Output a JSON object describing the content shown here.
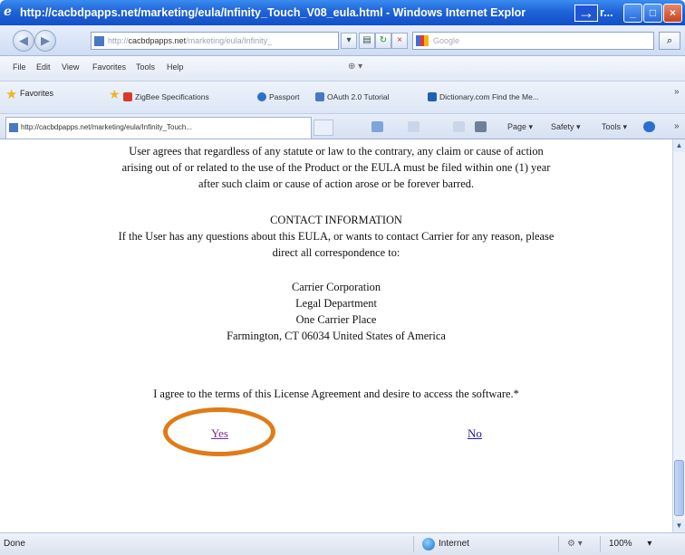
{
  "window": {
    "title": "http://cacbdpapps.net/marketing/eula/Infinity_Touch_V08_eula.html - Windows Internet Explor",
    "title_tail": "r...",
    "min_glyph": "_",
    "max_glyph": "□",
    "close_glyph": "×",
    "annotation_arrow": "→",
    "colors": {
      "titlebar": "#1f63d8",
      "annotation_circle": "#e07b17"
    }
  },
  "nav": {
    "back_glyph": "◀",
    "forward_glyph": "▶",
    "address": "http://cacbdpapps.net/marketing/eula/Infinity_",
    "address_prefix": "http://",
    "address_domain": "cacbdpapps.net",
    "address_path": "/marketing/eula/Infinity_",
    "refresh_glyph": "↻",
    "stop_glyph": "×",
    "search_placeholder": "Google",
    "search_go": "⌕"
  },
  "menu": {
    "items": [
      "File",
      "Edit",
      "View",
      "Favorites",
      "Tools",
      "Help"
    ],
    "tools_glyph": "⊕ ▾"
  },
  "favorites": {
    "button_label": "Favorites",
    "links": [
      "ZigBee Specifications",
      "Passport",
      "OAuth 2.0 Tutorial",
      "Dictionary.com Find the Me..."
    ],
    "overflow": "»"
  },
  "tabs": {
    "active_tab": "http://cacbdpapps.net/marketing/eula/Infinity_Touch...",
    "commands": [
      "Page ▾",
      "Safety ▾",
      "Tools ▾"
    ]
  },
  "content": {
    "statute_paragraph": [
      "User agrees that regardless of any statute or law to the contrary, any claim or cause of action",
      "arising out of or related to the use of the Product or the EULA must be filed within one (1) year",
      "after such claim or cause of action arose or be forever barred."
    ],
    "contact_heading": "CONTACT INFORMATION",
    "contact_paragraph": [
      "If the User has any questions about this EULA, or wants to contact Carrier for any reason, please",
      "direct all correspondence to:"
    ],
    "address": [
      "Carrier Corporation",
      "Legal Department",
      "One Carrier Place",
      "Farmington, CT 06034 United States of America"
    ],
    "agree_text": "I agree to the terms of this License Agreement and desire to access the software.*",
    "yes_link": "Yes",
    "no_link": "No"
  },
  "status": {
    "left": "Done",
    "zone": "Internet",
    "protected_mode_glyph": "⚙ ▾",
    "zoom": "100%",
    "zoom_glyph": "▾"
  }
}
